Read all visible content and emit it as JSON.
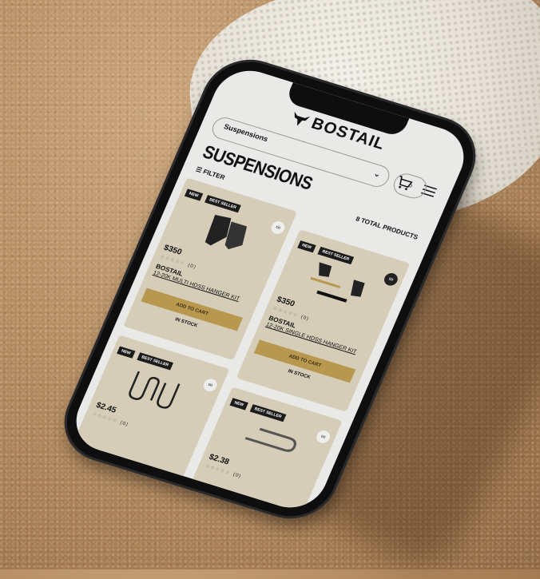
{
  "brand": {
    "name": "BOSTAIL",
    "logo_icon": "bull-head-icon"
  },
  "category_select": {
    "value": "Suspensions"
  },
  "page": {
    "title": "SUSPENSIONS",
    "filter_label": "FILTER",
    "total_label": "8 TOTAL PRODUCTS"
  },
  "icons": {
    "cart": "cart-icon",
    "menu": "menu-icon",
    "search": "search-icon",
    "filter": "sliders-icon",
    "link": "link-icon"
  },
  "badges": {
    "new": "NEW",
    "best_seller": "BEST SELLER"
  },
  "products": [
    {
      "price": "$350",
      "reviews": "(0)",
      "brand": "BOSTAIL",
      "name": "12-20K MULTI HDSS HANGER KIT",
      "cta": "ADD TO CART",
      "stock": "IN STOCK"
    },
    {
      "price": "$350",
      "reviews": "(0)",
      "brand": "BOSTAIL",
      "name": "12-20K SINGLE HDSS HANGER KIT",
      "cta": "ADD TO CART",
      "stock": "IN STOCK"
    },
    {
      "price": "$2.45",
      "reviews": "(0)"
    },
    {
      "price": "$2.38",
      "reviews": "(0)"
    }
  ],
  "colors": {
    "accent": "#b7984e",
    "card_bg": "#d5cdb8",
    "screen_bg": "#e9e9e7",
    "badge_bg": "#1b1b1b"
  }
}
